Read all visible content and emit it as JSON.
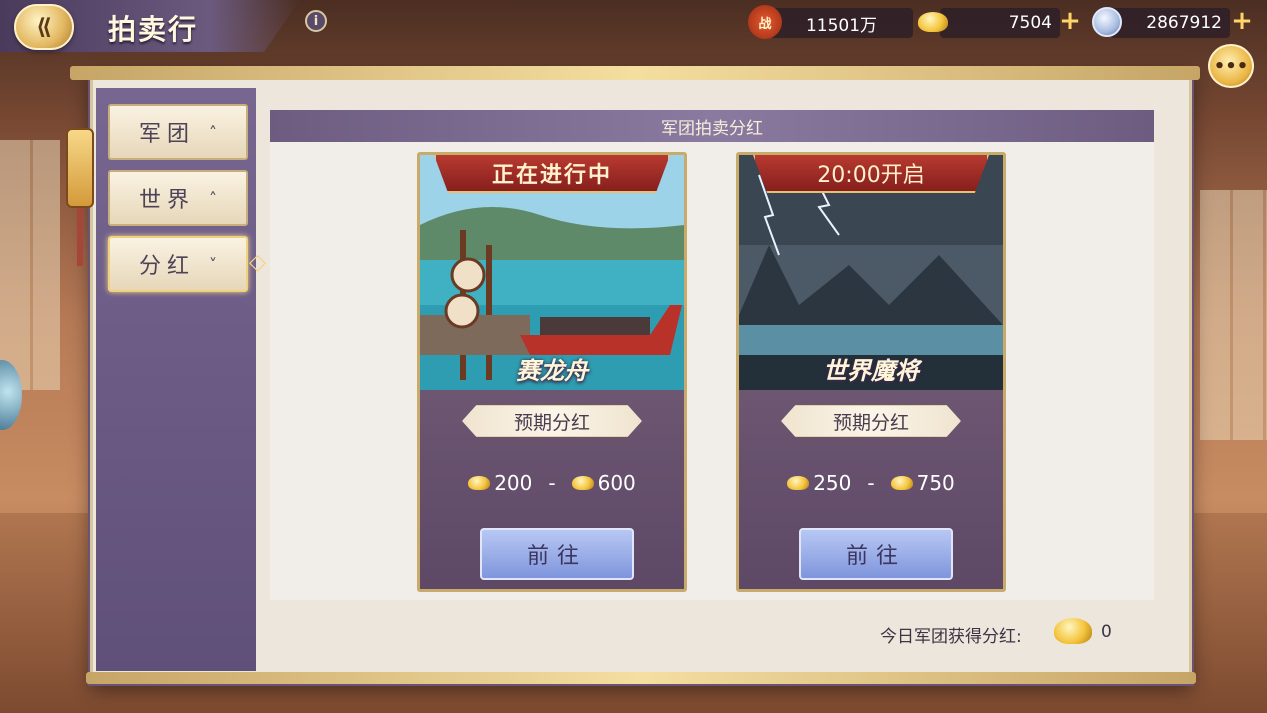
{
  "header": {
    "back_icon": "back-arrow-icon",
    "title": "拍卖行",
    "info_icon": "info-icon"
  },
  "resources": {
    "combat_power": {
      "icon": "battle-icon",
      "badge": "战",
      "value": "11501万"
    },
    "gold_ingots": {
      "icon": "gold-ingot-icon",
      "value": "7504"
    },
    "silver_coins": {
      "icon": "silver-coin-icon",
      "value": "2867912"
    },
    "plus": "+"
  },
  "chat_icon": "chat-bubble-icon",
  "sidebar": {
    "tabs": [
      {
        "label": "军团",
        "arrow": "^",
        "active": false
      },
      {
        "label": "世界",
        "arrow": "^",
        "active": false
      },
      {
        "label": "分红",
        "arrow": "v",
        "active": true
      }
    ]
  },
  "section": {
    "title": "军团拍卖分红"
  },
  "cards": [
    {
      "status": "正在进行中",
      "name": "赛龙舟",
      "label": "预期分红",
      "min": "200",
      "dash": "-",
      "max": "600",
      "button": "前往"
    },
    {
      "status": "20:00开启",
      "name": "世界魔将",
      "label": "预期分红",
      "min": "250",
      "dash": "-",
      "max": "750",
      "button": "前往"
    }
  ],
  "footer": {
    "today_label": "今日军团获得分红:",
    "today_value": "0"
  },
  "colors": {
    "accent_gold": "#e8c16f",
    "panel_purple": "#6d5c80",
    "button_blue": "#8fa3e2",
    "banner_red": "#a52d28"
  }
}
